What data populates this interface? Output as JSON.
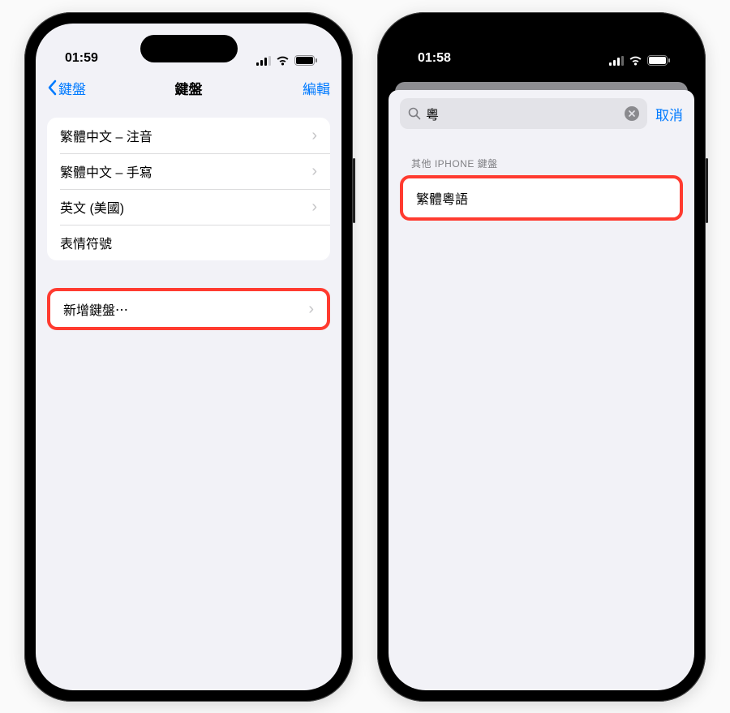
{
  "left": {
    "status": {
      "time": "01:59"
    },
    "nav": {
      "back": "鍵盤",
      "title": "鍵盤",
      "edit": "編輯"
    },
    "keyboards": [
      {
        "label": "繁體中文 – 注音",
        "chevron": true
      },
      {
        "label": "繁體中文 – 手寫",
        "chevron": true
      },
      {
        "label": "英文 (美國)",
        "chevron": true
      },
      {
        "label": "表情符號",
        "chevron": false
      }
    ],
    "add": {
      "label": "新增鍵盤⋯"
    }
  },
  "right": {
    "status": {
      "time": "01:58"
    },
    "search": {
      "value": "粵",
      "cancel": "取消"
    },
    "sectionHeader": "其他 IPHONE 鍵盤",
    "result": {
      "label": "繁體粵語"
    }
  }
}
